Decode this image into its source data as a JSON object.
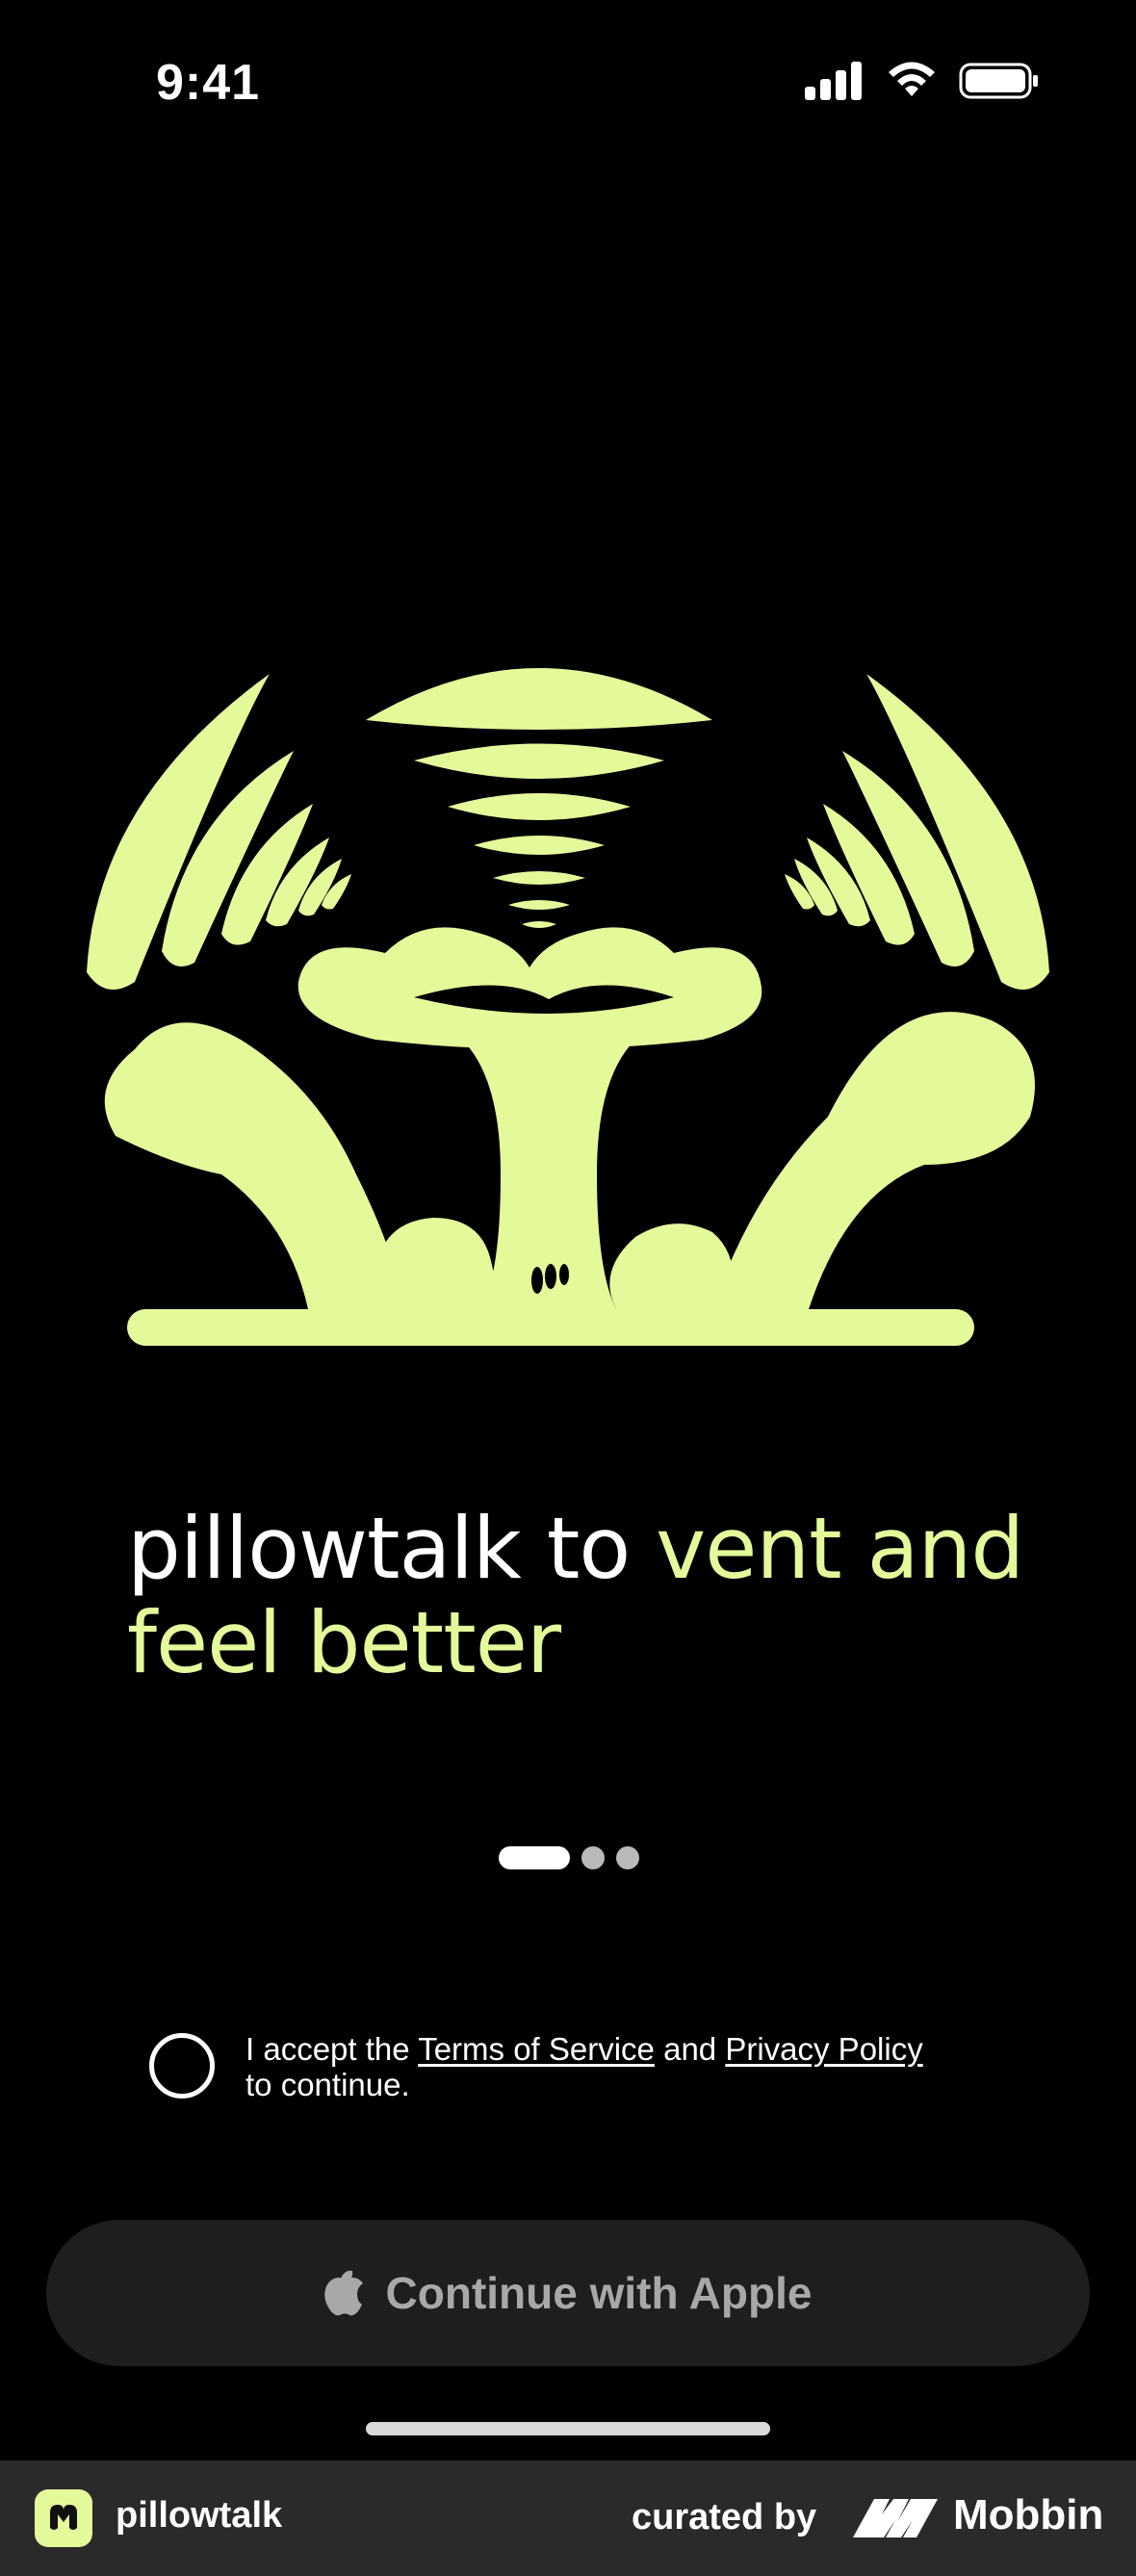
{
  "status_bar": {
    "time": "9:41",
    "icons": [
      "cellular-signal-icon",
      "wifi-icon",
      "battery-icon"
    ]
  },
  "illustration": {
    "icon": "face-speaking-illustration",
    "color": "#e4f99a"
  },
  "headline": {
    "part_white": "pillowtalk to ",
    "part_accent": "vent and feel better",
    "accent_color": "#e4f99a"
  },
  "pager": {
    "total": 3,
    "active_index": 0
  },
  "consent": {
    "prefix": "I accept the ",
    "terms_link": "Terms of Service",
    "middle": " and ",
    "privacy_link": "Privacy Policy",
    "suffix": " to continue.",
    "checked": false
  },
  "apple_button": {
    "icon": "apple-logo-icon",
    "label": "Continue with Apple"
  },
  "footer": {
    "app_name": "pillowtalk",
    "curated_by": "curated by",
    "brand": "Mobbin"
  }
}
